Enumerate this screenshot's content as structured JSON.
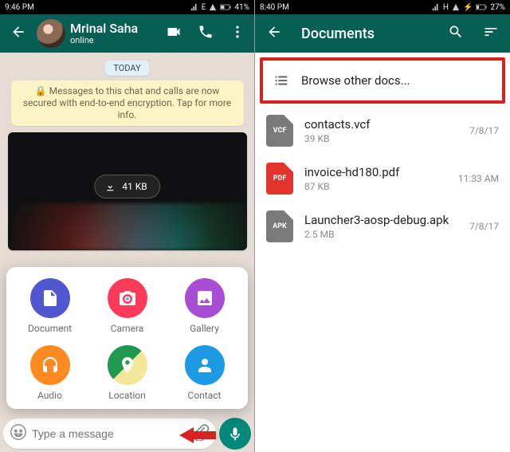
{
  "left": {
    "status_time": "9:46 PM",
    "battery": "41%",
    "signal_label": "E",
    "contact_name": "Mrinal Saha",
    "contact_status": "online",
    "today_label": "TODAY",
    "encryption_notice": "🔒 Messages to this chat and calls are now secured with end-to-end encryption. Tap for more info.",
    "download_size": "41 KB",
    "input_placeholder": "Type a message",
    "attachments": [
      {
        "label": "Document",
        "color": "#5157ce",
        "icon": "doc"
      },
      {
        "label": "Camera",
        "color": "#ff3a5a",
        "icon": "cam"
      },
      {
        "label": "Gallery",
        "color": "#a84ed4",
        "icon": "img"
      },
      {
        "label": "Audio",
        "color": "#ff8a1f",
        "icon": "aud"
      },
      {
        "label": "Location",
        "color": "#13a456",
        "icon": "loc"
      },
      {
        "label": "Contact",
        "color": "#1e9ae4",
        "icon": "con"
      }
    ]
  },
  "right": {
    "status_time": "8:40 PM",
    "battery": "27%",
    "signal_label": "H",
    "title": "Documents",
    "browse_label": "Browse other docs...",
    "files": [
      {
        "name": "contacts.vcf",
        "size": "39 KB",
        "date": "7/8/17",
        "badge": "VCF",
        "color": "#7a7a7a"
      },
      {
        "name": "invoice-hd180.pdf",
        "size": "87 KB",
        "date": "11:33 AM",
        "badge": "PDF",
        "color": "#e2332c"
      },
      {
        "name": "Launcher3-aosp-debug.apk",
        "size": "2.5 MB",
        "date": "7/8/17",
        "badge": "APK",
        "color": "#7a7a7a"
      }
    ]
  }
}
